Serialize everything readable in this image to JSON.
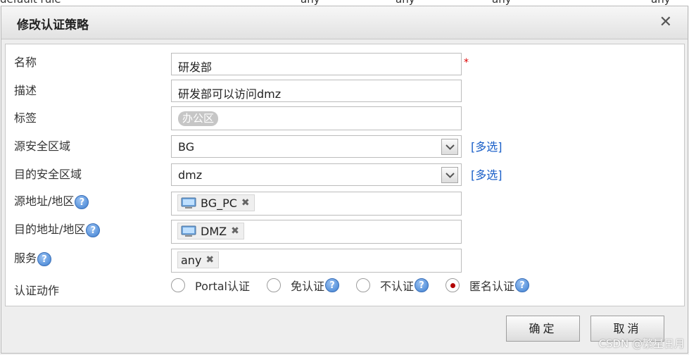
{
  "background_row": {
    "name": "default rule",
    "cells": [
      "any",
      "any",
      "any",
      "any"
    ]
  },
  "dialog": {
    "title": "修改认证策略",
    "close_symbol": "✕"
  },
  "form": {
    "name": {
      "label": "名称",
      "value": "研发部",
      "required_mark": "*"
    },
    "description": {
      "label": "描述",
      "value": "研发部可以访问dmz"
    },
    "tags": {
      "label": "标签",
      "tag": "办公区"
    },
    "src_zone": {
      "label": "源安全区域",
      "value": "BG",
      "multi_select": "[多选]"
    },
    "dst_zone": {
      "label": "目的安全区域",
      "value": "dmz",
      "multi_select": "[多选]"
    },
    "src_addr": {
      "label": "源地址/地区",
      "chip": "BG_PC",
      "chip_icon": "computer-icon"
    },
    "dst_addr": {
      "label": "目的地址/地区",
      "chip": "DMZ",
      "chip_icon": "computer-icon"
    },
    "service": {
      "label": "服务",
      "chip": "any"
    },
    "auth_action": {
      "label": "认证动作",
      "options": [
        {
          "label": "Portal认证",
          "selected": false,
          "help": false
        },
        {
          "label": "免认证",
          "selected": false,
          "help": true
        },
        {
          "label": "不认证",
          "selected": false,
          "help": true
        },
        {
          "label": "匿名认证",
          "selected": true,
          "help": true
        }
      ]
    },
    "help_symbol": "?",
    "remove_symbol": "✖"
  },
  "footer": {
    "ok_label": "确定",
    "cancel_label": "取消"
  },
  "watermark": "CSDN @繁星日月",
  "colors": {
    "link": "#1a5fc8",
    "required": "#dd0000",
    "radio_selected": "#b20000",
    "help_icon": "#3d7fd1"
  }
}
